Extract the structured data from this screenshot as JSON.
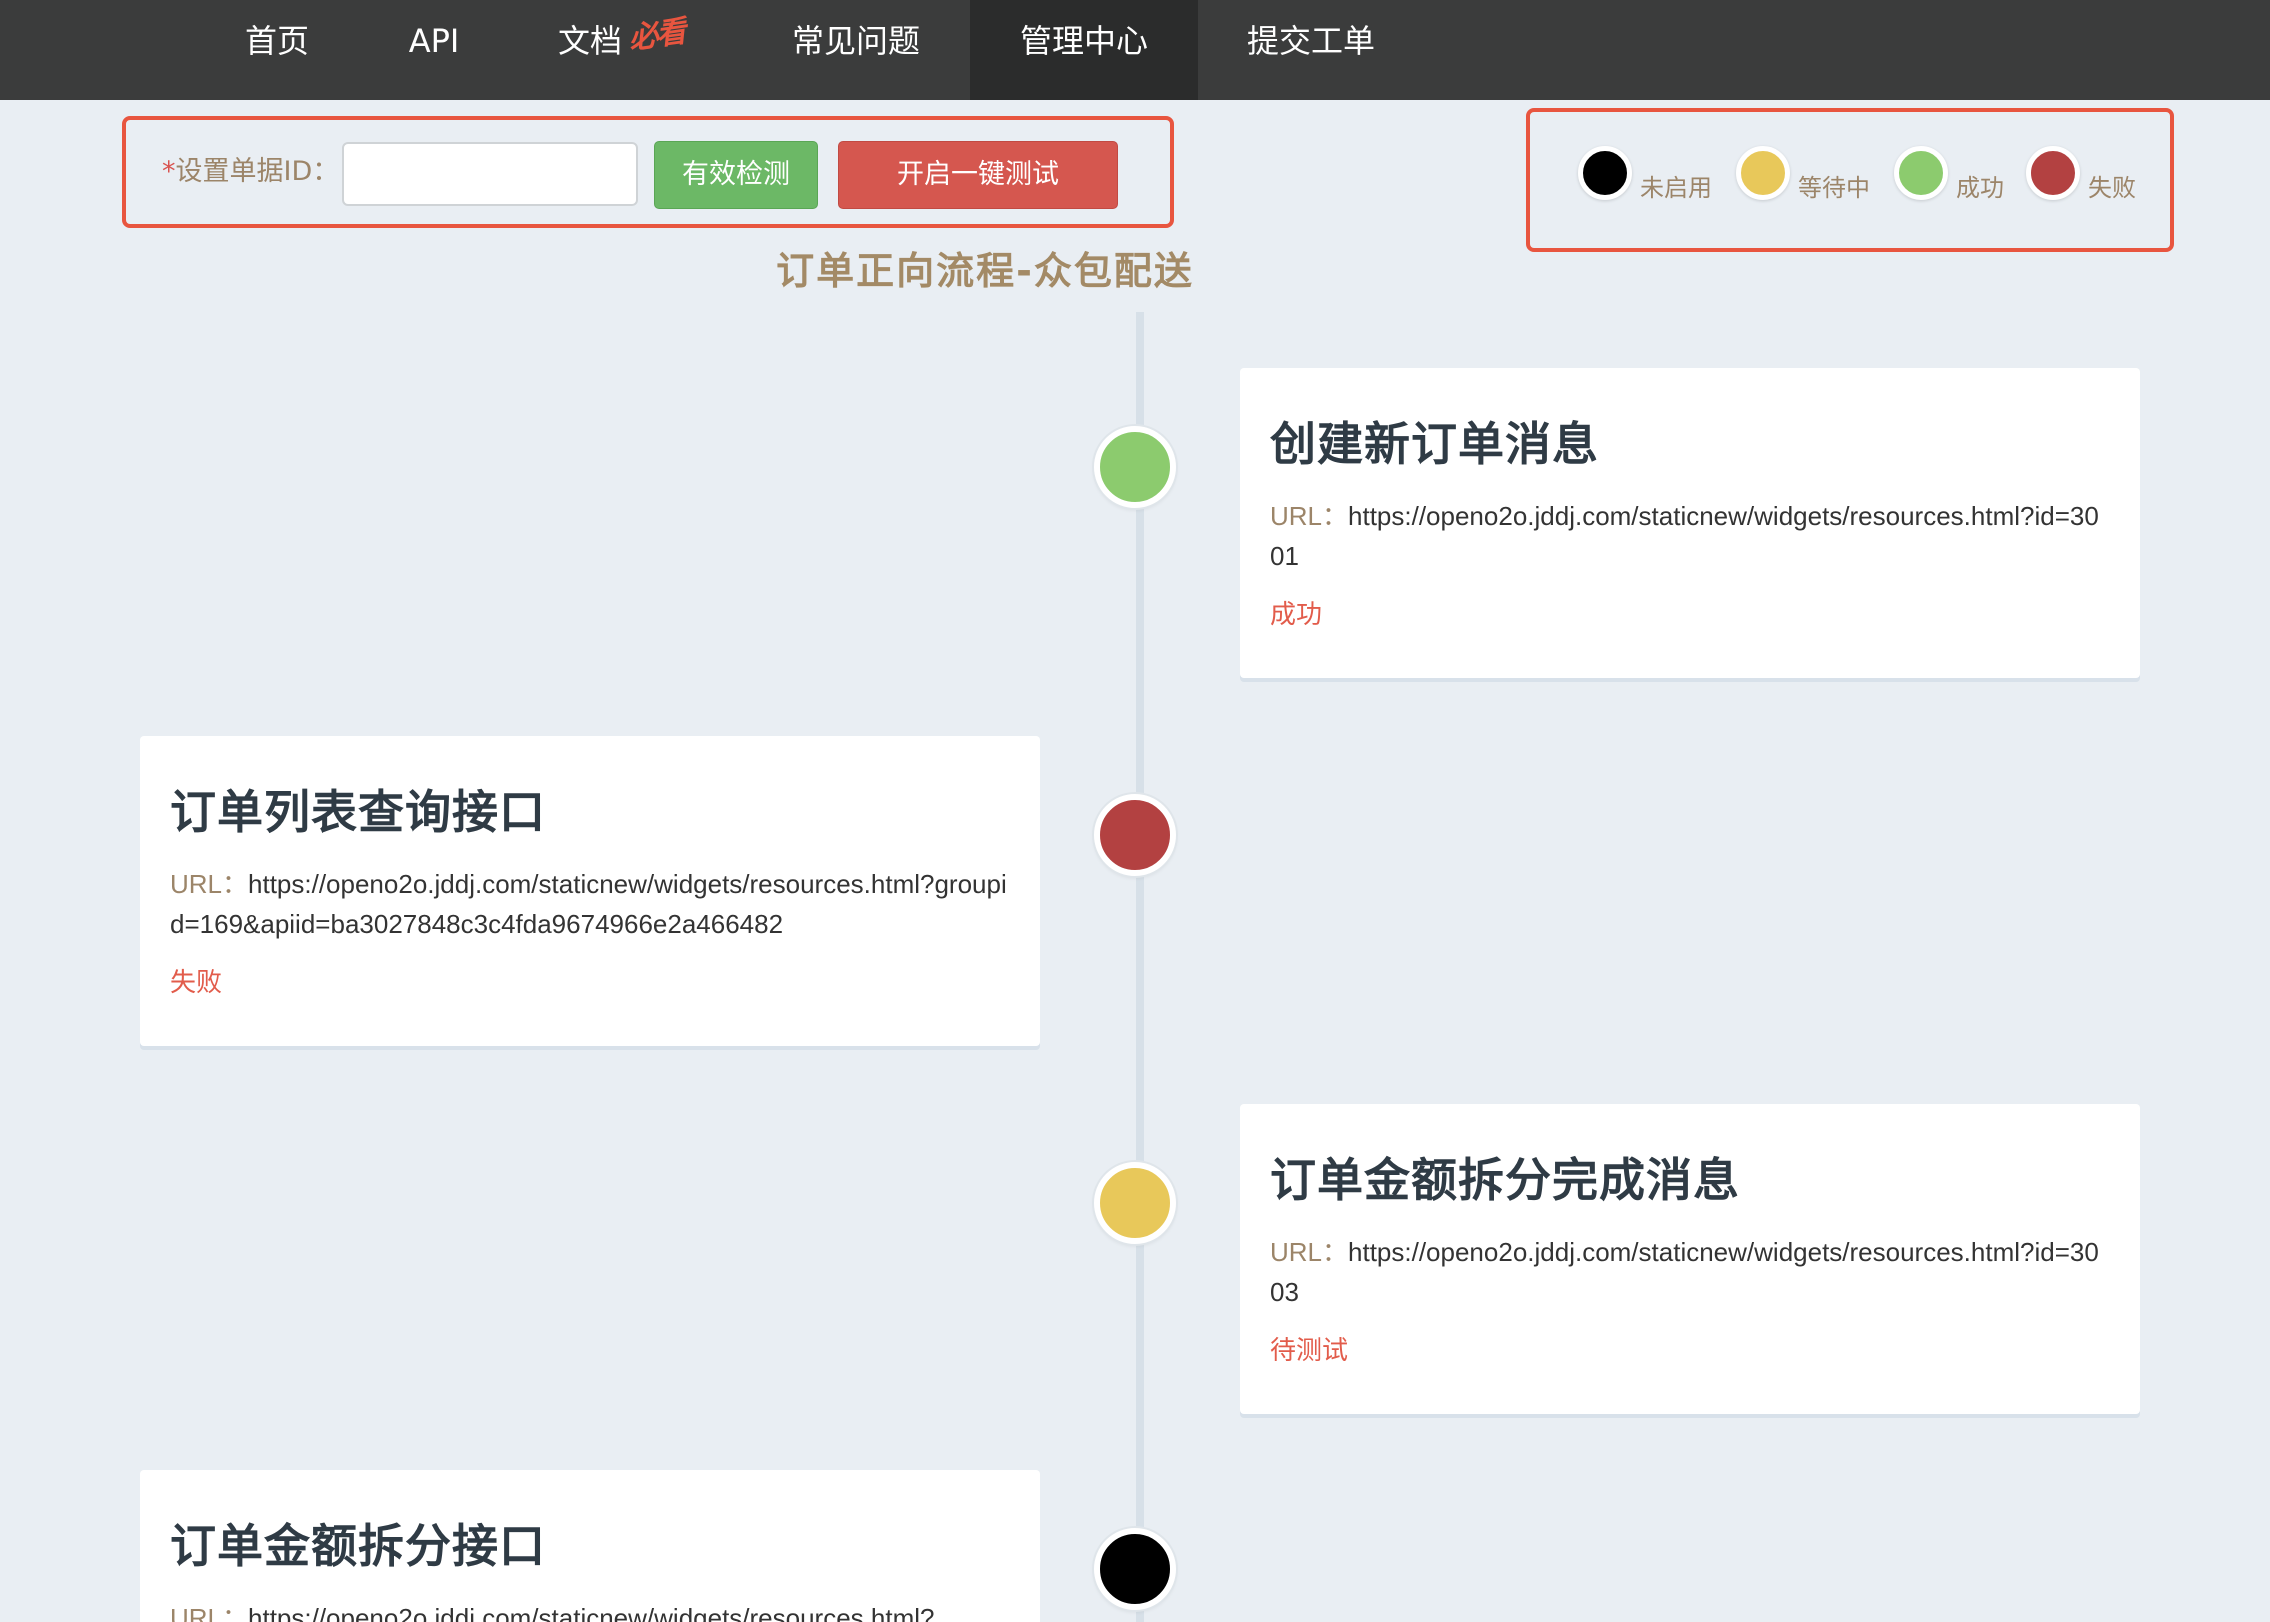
{
  "colors": {
    "nav_bg": "#3b3c3c",
    "accent_red": "#e8553f",
    "btn_green": "#6cb866",
    "btn_red": "#d5574f",
    "status_disabled": "#000000",
    "status_waiting": "#e8c85a",
    "status_success": "#8ccb6e",
    "status_failed": "#b34141"
  },
  "nav": {
    "items": [
      {
        "label": "首页"
      },
      {
        "label": "API"
      },
      {
        "label": "文档"
      },
      {
        "label": "常见问题"
      },
      {
        "label": "管理中心",
        "active": true
      },
      {
        "label": "提交工单"
      }
    ],
    "docs_badge": "必看"
  },
  "controls": {
    "required_mark": "*",
    "label": "设置单据ID：",
    "input_value": "",
    "check_button": "有效检测",
    "run_button": "开启一键测试"
  },
  "legend": [
    {
      "label": "未启用",
      "color": "#000000"
    },
    {
      "label": "等待中",
      "color": "#e8c85a"
    },
    {
      "label": "成功",
      "color": "#8ccb6e"
    },
    {
      "label": "失败",
      "color": "#b34141"
    }
  ],
  "flow_title": "订单正向流程-众包配送",
  "steps": [
    {
      "title": "创建新订单消息",
      "url_label": "URL：",
      "url": "https://openo2o.jddj.com/staticnew/widgets/resources.html?id=3001",
      "status": "成功",
      "node_state": "success"
    },
    {
      "title": "订单列表查询接口",
      "url_label": "URL：",
      "url": "https://openo2o.jddj.com/staticnew/widgets/resources.html?groupid=169&apiid=ba3027848c3c4fda9674966e2a466482",
      "status": "失败",
      "node_state": "failed"
    },
    {
      "title": "订单金额拆分完成消息",
      "url_label": "URL：",
      "url": "https://openo2o.jddj.com/staticnew/widgets/resources.html?id=3003",
      "status": "待测试",
      "node_state": "waiting"
    },
    {
      "title": "订单金额拆分接口",
      "url_label": "URL：",
      "url": "https://openo2o.jddj.com/staticnew/widgets/resources.html?",
      "status": "",
      "node_state": "disabled"
    }
  ]
}
